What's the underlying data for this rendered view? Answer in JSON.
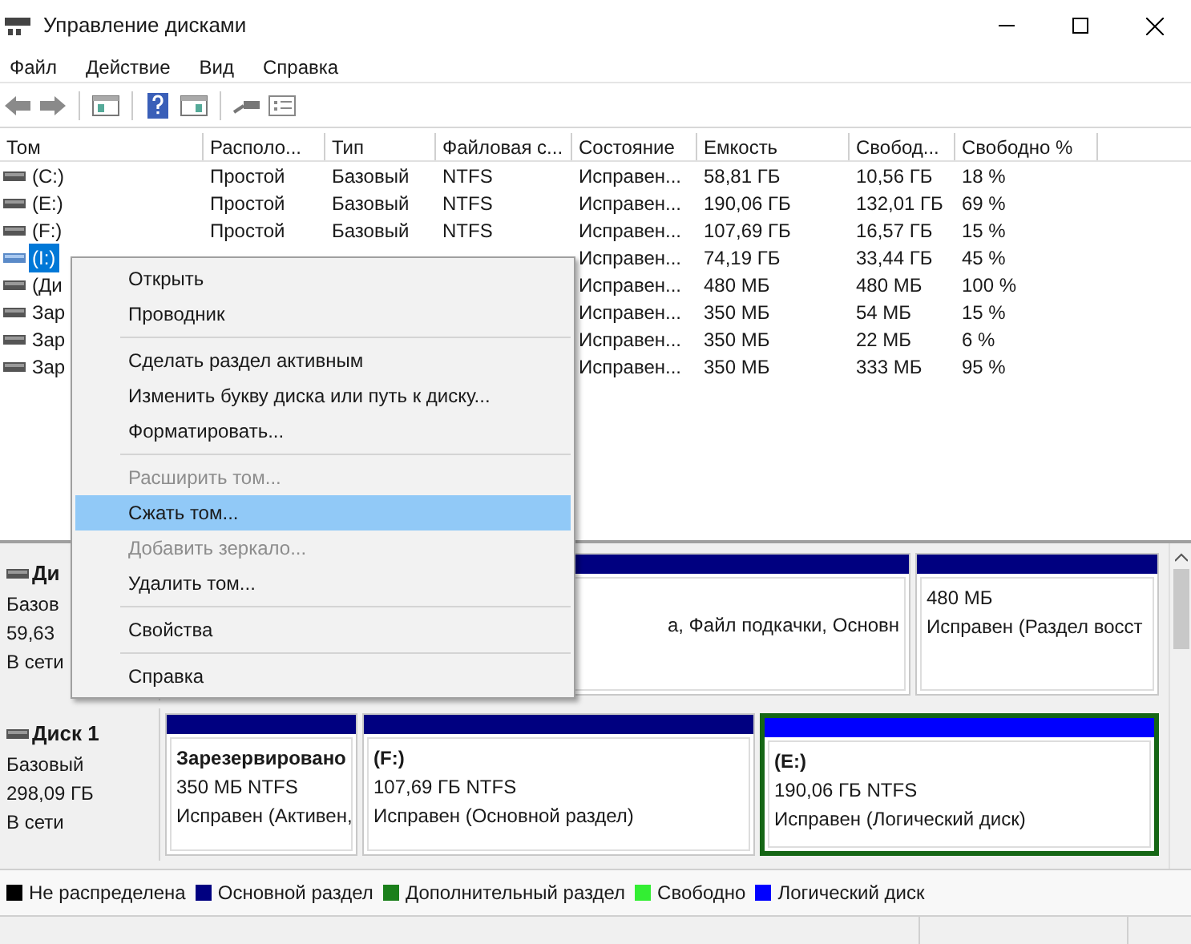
{
  "window": {
    "title": "Управление дисками"
  },
  "menu_bar": [
    "Файл",
    "Действие",
    "Вид",
    "Справка"
  ],
  "table": {
    "columns": [
      "Том",
      "Располо...",
      "Тип",
      "Файловая с...",
      "Состояние",
      "Емкость",
      "Свобод...",
      "Свободно %"
    ],
    "rows": [
      {
        "cells": [
          "(C:)",
          "Простой",
          "Базовый",
          "NTFS",
          "Исправен...",
          "58,81 ГБ",
          "10,56 ГБ",
          "18 %"
        ],
        "selected": false
      },
      {
        "cells": [
          "(E:)",
          "Простой",
          "Базовый",
          "NTFS",
          "Исправен...",
          "190,06 ГБ",
          "132,01 ГБ",
          "69 %"
        ],
        "selected": false
      },
      {
        "cells": [
          "(F:)",
          "Простой",
          "Базовый",
          "NTFS",
          "Исправен...",
          "107,69 ГБ",
          "16,57 ГБ",
          "15 %"
        ],
        "selected": false
      },
      {
        "cells": [
          "(I:)",
          null,
          null,
          null,
          "Исправен...",
          "74,19 ГБ",
          "33,44 ГБ",
          "45 %"
        ],
        "selected": true
      },
      {
        "cells": [
          "(Ди",
          null,
          null,
          null,
          "Исправен...",
          "480 МБ",
          "480 МБ",
          "100 %"
        ],
        "selected": false
      },
      {
        "cells": [
          "Зар",
          null,
          null,
          null,
          "Исправен...",
          "350 МБ",
          "54 МБ",
          "15 %"
        ],
        "selected": false
      },
      {
        "cells": [
          "Зар",
          null,
          null,
          null,
          "Исправен...",
          "350 МБ",
          "22 МБ",
          "6 %"
        ],
        "selected": false
      },
      {
        "cells": [
          "Зар",
          null,
          null,
          null,
          "Исправен...",
          "350 МБ",
          "333 МБ",
          "95 %"
        ],
        "selected": false
      }
    ]
  },
  "context_menu": [
    {
      "kind": "item",
      "label": "Открыть",
      "disabled": false,
      "selected": false
    },
    {
      "kind": "item",
      "label": "Проводник",
      "disabled": false,
      "selected": false
    },
    {
      "kind": "separator"
    },
    {
      "kind": "item",
      "label": "Сделать раздел активным",
      "disabled": false,
      "selected": false
    },
    {
      "kind": "item",
      "label": "Изменить букву диска или путь к диску...",
      "disabled": false,
      "selected": false
    },
    {
      "kind": "item",
      "label": "Форматировать...",
      "disabled": false,
      "selected": false
    },
    {
      "kind": "separator"
    },
    {
      "kind": "item",
      "label": "Расширить том...",
      "disabled": true,
      "selected": false
    },
    {
      "kind": "item",
      "label": "Сжать том...",
      "disabled": false,
      "selected": true
    },
    {
      "kind": "item",
      "label": "Добавить зеркало...",
      "disabled": true,
      "selected": false
    },
    {
      "kind": "item",
      "label": "Удалить том...",
      "disabled": false,
      "selected": false
    },
    {
      "kind": "separator"
    },
    {
      "kind": "item",
      "label": "Свойства",
      "disabled": false,
      "selected": false
    },
    {
      "kind": "separator"
    },
    {
      "kind": "item",
      "label": "Справка",
      "disabled": false,
      "selected": false
    }
  ],
  "disks": [
    {
      "name": "Ди",
      "lines": [
        "Базов",
        "59,63",
        "В сети"
      ],
      "partitions": [
        {
          "status": "а, Файл подкачки, Основн",
          "color": "#000080",
          "selected": false
        },
        {
          "size": "480 МБ",
          "status": "Исправен (Раздел восст",
          "color": "#000080",
          "selected": false
        }
      ]
    },
    {
      "name": "Диск 1",
      "lines": [
        "Базовый",
        "298,09 ГБ",
        "В сети"
      ],
      "partitions": [
        {
          "name": "Зарезервировано",
          "size": "350 МБ NTFS",
          "status": "Исправен (Активен,",
          "color": "#000080",
          "selected": false
        },
        {
          "name": "(F:)",
          "size": "107,69 ГБ NTFS",
          "status": "Исправен (Основной раздел)",
          "color": "#000080",
          "selected": false
        },
        {
          "name": "(E:)",
          "size": "190,06 ГБ NTFS",
          "status": "Исправен (Логический диск)",
          "color": "#0000ff",
          "selected": true
        }
      ]
    }
  ],
  "legend": [
    {
      "label": "Не распределена",
      "color": "#000000"
    },
    {
      "label": "Основной раздел",
      "color": "#000080"
    },
    {
      "label": "Дополнительный раздел",
      "color": "#1a7f1a"
    },
    {
      "label": "Свободно",
      "color": "#33ee33"
    },
    {
      "label": "Логический диск",
      "color": "#0000ff"
    }
  ]
}
